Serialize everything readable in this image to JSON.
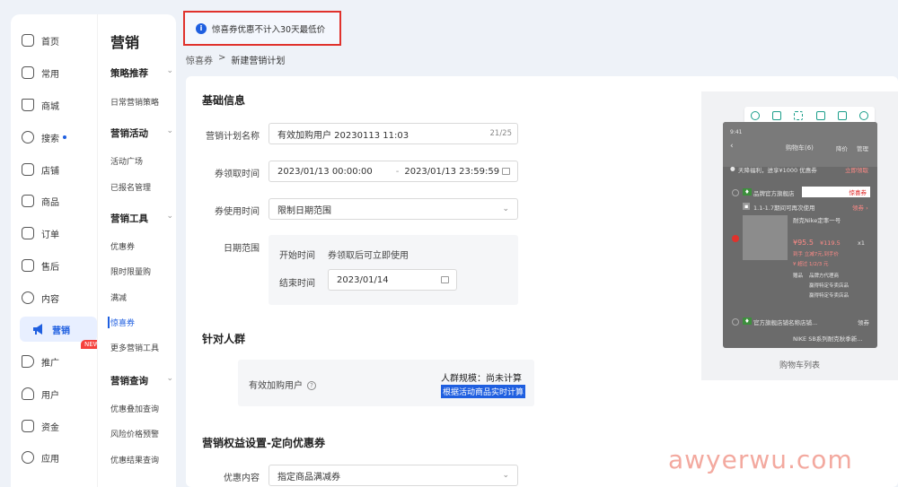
{
  "nav": {
    "items": [
      {
        "label": "首页",
        "icon": "home-icon"
      },
      {
        "label": "常用",
        "icon": "folder-icon"
      },
      {
        "label": "商城",
        "icon": "shop-icon"
      },
      {
        "label": "搜索",
        "icon": "search-icon"
      },
      {
        "label": "店铺",
        "icon": "store-icon"
      },
      {
        "label": "商品",
        "icon": "goods-icon"
      },
      {
        "label": "订单",
        "icon": "order-icon"
      },
      {
        "label": "售后",
        "icon": "aftersale-icon"
      },
      {
        "label": "内容",
        "icon": "content-icon"
      },
      {
        "label": "营销",
        "icon": "megaphone-icon"
      },
      {
        "label": "推广",
        "icon": "promote-icon"
      },
      {
        "label": "用户",
        "icon": "user-icon"
      },
      {
        "label": "资金",
        "icon": "wallet-icon"
      },
      {
        "label": "应用",
        "icon": "app-icon"
      }
    ],
    "new_badge": "NEW",
    "accent": "#1f5fe0"
  },
  "subnav": {
    "title": "营销",
    "groups": [
      {
        "label": "策略推荐",
        "items": [
          "日常营销策略"
        ]
      },
      {
        "label": "营销活动",
        "items": [
          "活动广场",
          "已报名管理"
        ]
      },
      {
        "label": "营销工具",
        "items": [
          "优惠券",
          "限时限量购",
          "满减",
          "惊喜券",
          "更多营销工具"
        ]
      },
      {
        "label": "营销查询",
        "items": [
          "优惠叠加查询",
          "风险价格预警",
          "优惠结果查询"
        ]
      }
    ],
    "chevron": "⌄"
  },
  "notice": {
    "text": "惊喜券优惠不计入30天最低价",
    "icon": "info-icon",
    "highlight": "#e0322c"
  },
  "breadcrumb": {
    "parent": "惊喜券",
    "separator": ">",
    "current": "新建营销计划"
  },
  "basic": {
    "title": "基础信息",
    "plan_name_label": "营销计划名称",
    "plan_name_value": "有效加购用户 20230113 11:03",
    "plan_name_count": "21/25",
    "claim_time_label": "券领取时间",
    "claim_start": "2023/01/13 00:00:00",
    "claim_sep": "-",
    "claim_end": "2023/01/13 23:59:59",
    "use_time_label": "券使用时间",
    "use_time_value": "限制日期范围",
    "date_range_label": "日期范围",
    "start_label": "开始时间",
    "start_value": "券领取后可立即使用",
    "end_label": "结束时间",
    "end_value": "2023/01/14"
  },
  "audience": {
    "title": "针对人群",
    "name": "有效加购用户",
    "scale_text": "人群规模：尚未计算",
    "calc_button": "根据活动商品实时计算"
  },
  "benefit": {
    "title": "营销权益设置-定向优惠券",
    "content_label": "优惠内容",
    "content_value": "指定商品满减券"
  },
  "preview": {
    "caption": "购物车列表",
    "toolbar_icons": [
      "zoom-icon",
      "copy-icon",
      "expand-icon",
      "save-icon",
      "share-icon",
      "settings-icon"
    ],
    "phone": {
      "time": "9:41",
      "title": "购物车(6)",
      "action1": "降价",
      "action2": "管理",
      "promo": "天降福利，进享¥1000 优惠券",
      "promo_link": "立即领取",
      "shop1": "品牌官方旗舰店",
      "coupon_tag": "惊喜券",
      "promo_line": "1.1-1.7期间可再次使用",
      "promo_more": "领券 ›",
      "product": "耐克Nike定率一号",
      "price": "¥95.5",
      "price_old": "¥119.5",
      "qty": "x1",
      "price_note": "到手 立减7元,到手价",
      "price_note2": "¥ 超过 1/2/3 元",
      "gift_label": "赠品",
      "gift1": "品牌方代理商",
      "gift2": "赢得特定专卖店品",
      "gift3": "赢得特定专卖店品",
      "shop2": "官方旗舰店铺名称店铺...",
      "shop2_action": "领券",
      "product2": "NIKE SB系列耐克秋季新..."
    }
  },
  "watermark": "awyerwu.com"
}
